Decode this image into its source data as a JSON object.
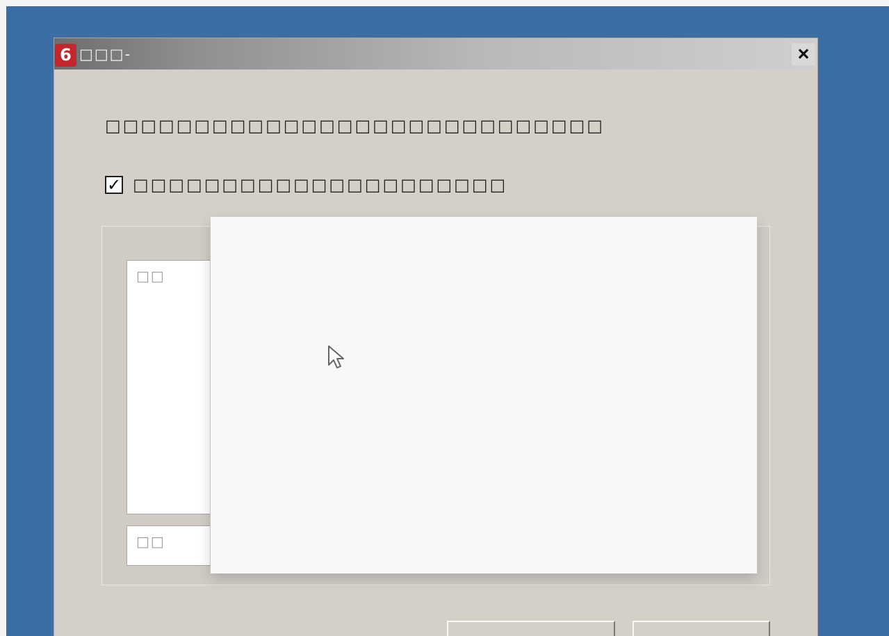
{
  "window": {
    "title": "□□□-",
    "close_label": "×",
    "icon_glyph": "6"
  },
  "dialog": {
    "instruction": "□□□□□□□□□□□□□□□□□□□□□□□□□□□□",
    "checkbox_checked": true,
    "checkbox_mark": "✓",
    "checkbox_label": "□□□□□□□□□□□□□□□□□□□□□",
    "list_item": "□□",
    "input_value": "□□",
    "primary_button": "□□□□□□",
    "secondary_button": "□□"
  },
  "popup": {
    "visible": true
  },
  "cursor": {
    "icon": "mouse-pointer-icon"
  },
  "colors": {
    "desktop": "#3b6ea5",
    "dialog": "#d4d0c8",
    "popup": "#f7f7f6",
    "app_icon": "#c7252d"
  }
}
